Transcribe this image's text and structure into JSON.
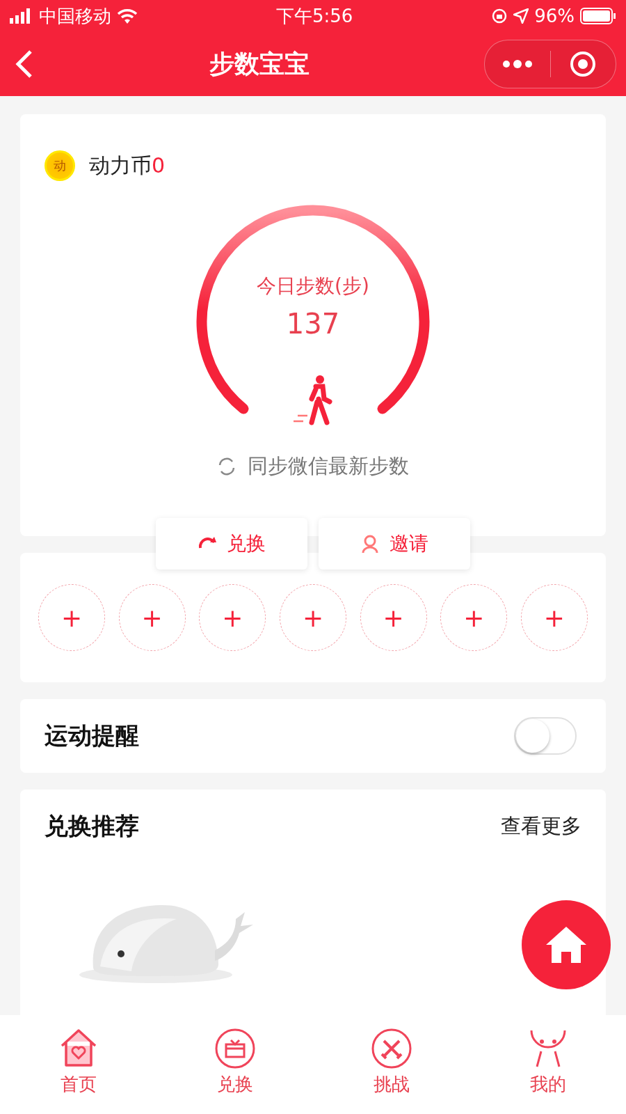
{
  "status_bar": {
    "carrier": "中国移动",
    "time": "下午5:56",
    "battery": "96%"
  },
  "nav": {
    "title": "步数宝宝"
  },
  "coins": {
    "coin_glyph": "动",
    "label": "动力币",
    "value": "0"
  },
  "steps": {
    "label": "今日步数(步)",
    "value": "137",
    "sync": "同步微信最新步数"
  },
  "actions": [
    {
      "kind": "exchange",
      "label": "兑换"
    },
    {
      "kind": "invite",
      "label": "邀请"
    }
  ],
  "slots": [
    {
      "symbol": "+"
    },
    {
      "symbol": "+"
    },
    {
      "symbol": "+"
    },
    {
      "symbol": "+"
    },
    {
      "symbol": "+"
    },
    {
      "symbol": "+"
    },
    {
      "symbol": "+"
    }
  ],
  "reminder": {
    "title": "运动提醒",
    "on": false
  },
  "recommend": {
    "title": "兑换推荐",
    "more": "查看更多"
  },
  "tabs": [
    {
      "kind": "home",
      "label": "首页",
      "selected": true
    },
    {
      "kind": "exchange",
      "label": "兑换",
      "selected": false
    },
    {
      "kind": "challenge",
      "label": "挑战",
      "selected": false
    },
    {
      "kind": "mine",
      "label": "我的",
      "selected": false
    }
  ]
}
